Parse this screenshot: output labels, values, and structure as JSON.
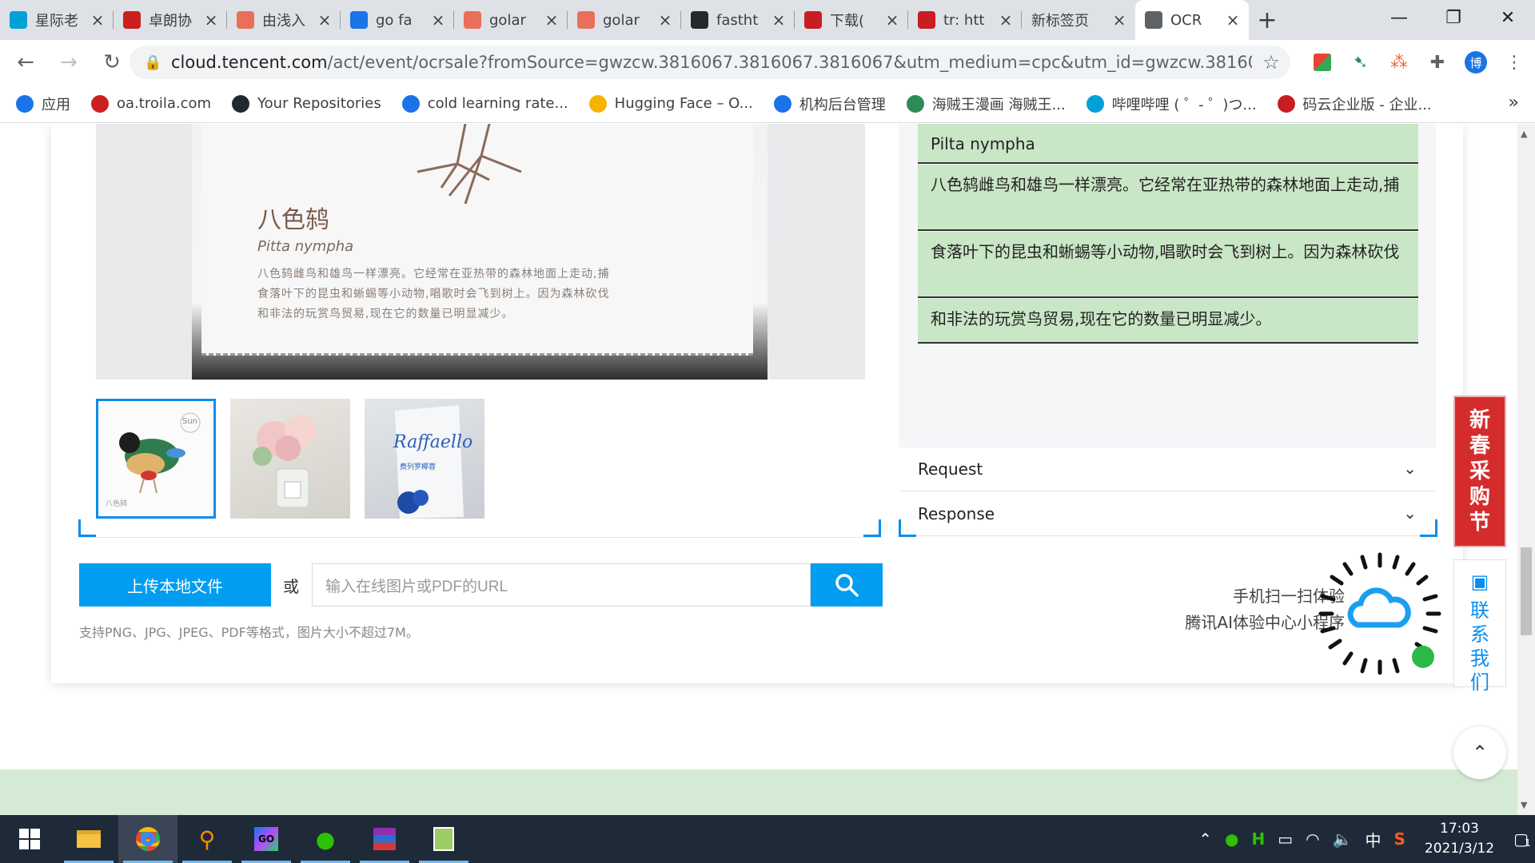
{
  "browser": {
    "tabs": [
      {
        "title": "星际老",
        "favicon": "bilibili-icon",
        "color": "#00a1d6"
      },
      {
        "title": "卓朗协",
        "favicon": "red-circle-icon",
        "color": "#cc1f1f"
      },
      {
        "title": "由浅入",
        "favicon": "jianshu-icon",
        "color": "#ea6f5a"
      },
      {
        "title": "go fa",
        "favicon": "bing-icon",
        "color": "#1a73e8"
      },
      {
        "title": "golar",
        "favicon": "jianshu-icon",
        "color": "#ea6f5a"
      },
      {
        "title": "golar",
        "favicon": "jianshu-icon",
        "color": "#ea6f5a"
      },
      {
        "title": "fastht",
        "favicon": "github-icon",
        "color": "#24292e"
      },
      {
        "title": "下载(",
        "favicon": "gitee-icon",
        "color": "#c71d23"
      },
      {
        "title": "tr: htt",
        "favicon": "gitee-icon",
        "color": "#c71d23"
      },
      {
        "title": "新标签页",
        "favicon": "",
        "color": ""
      },
      {
        "title": "OCR",
        "favicon": "chrome-globe-icon",
        "color": "#5f6368"
      }
    ],
    "new_tab_label": "+",
    "window_controls": {
      "minimize": "—",
      "restore": "❐",
      "close": "✕"
    },
    "url_host": "cloud.tencent.com",
    "url_path": "/act/event/ocrsale?fromSource=gwzcw.3816067.3816067.3816067&utm_medium=cpc&utm_id=gwzcw.3816067....",
    "profile_initial": "博",
    "bookmarks": [
      {
        "label": "应用",
        "icon": "apps-grid-icon"
      },
      {
        "label": "oa.troila.com",
        "icon": "red-circle-icon"
      },
      {
        "label": "Your Repositories",
        "icon": "github-icon"
      },
      {
        "label": "cold learning rate...",
        "icon": "bing-icon"
      },
      {
        "label": "Hugging Face – O...",
        "icon": "hugging-face-icon"
      },
      {
        "label": "机构后台管理",
        "icon": "shield-icon"
      },
      {
        "label": "海贼王漫画 海贼王...",
        "icon": "leaf-icon"
      },
      {
        "label": "哔哩哔哩 ( ゜- ゜)つ...",
        "icon": "bilibili-tv-icon"
      },
      {
        "label": "码云企业版 - 企业...",
        "icon": "gitee-icon"
      }
    ],
    "bookmarks_more": "»"
  },
  "demo": {
    "photo": {
      "bird_name": "八色鸫",
      "latin": "Pitta nympha",
      "lines": [
        "八色鸫雌鸟和雄鸟一样漂亮。它经常在亚热带的森林地面上走动,捕",
        "食落叶下的昆虫和蜥蜴等小动物,唱歌时会飞到树上。因为森林砍伐",
        "和非法的玩赏鸟贸易,现在它的数量已明显减少。"
      ]
    },
    "thumbnails": [
      {
        "name": "bird-card",
        "caption": "Sun",
        "label": "八色鸫",
        "selected": true
      },
      {
        "name": "flower-vase",
        "caption": "",
        "label": "",
        "selected": false
      },
      {
        "name": "raffaello-box",
        "caption": "Raffaello",
        "label": "费列罗椰蓉",
        "selected": false
      }
    ],
    "upload_label": "上传本地文件",
    "or_label": "或",
    "url_placeholder": "输入在线图片或PDF的URL",
    "hint": "支持PNG、JPG、JPEG、PDF等格式，图片大小不超过7M。"
  },
  "results": {
    "rows": [
      "Pilta nympha",
      "八色鸫雌鸟和雄鸟一样漂亮。它经常在亚热带的森林地面上走动,捕",
      "食落叶下的昆虫和蜥蜴等小动物,唱歌时会飞到树上。因为森林砍伐",
      "和非法的玩赏鸟贸易,现在它的数量已明显减少。"
    ],
    "request_label": "Request",
    "response_label": "Response"
  },
  "miniprogram": {
    "line1": "手机扫一扫体验",
    "line2": "腾讯AI体验中心小程序"
  },
  "side": {
    "promo": [
      "新",
      "春",
      "采",
      "购",
      "节"
    ],
    "contact": [
      "联",
      "系",
      "我",
      "们"
    ],
    "back_to_top": "⌃"
  },
  "taskbar": {
    "apps": [
      "windows-start-icon",
      "file-explorer-icon",
      "chrome-icon",
      "search-magnifier-icon",
      "goland-icon",
      "wechat-icon",
      "winrar-icon",
      "notepad-icon"
    ],
    "ime": "中",
    "time": "17:03",
    "date": "2021/3/12",
    "notification_count": "1"
  },
  "colors": {
    "accent": "#009df0",
    "result_bg": "#c9e6c6",
    "promo": "#d42c2c",
    "taskbar": "#1f2a38"
  }
}
